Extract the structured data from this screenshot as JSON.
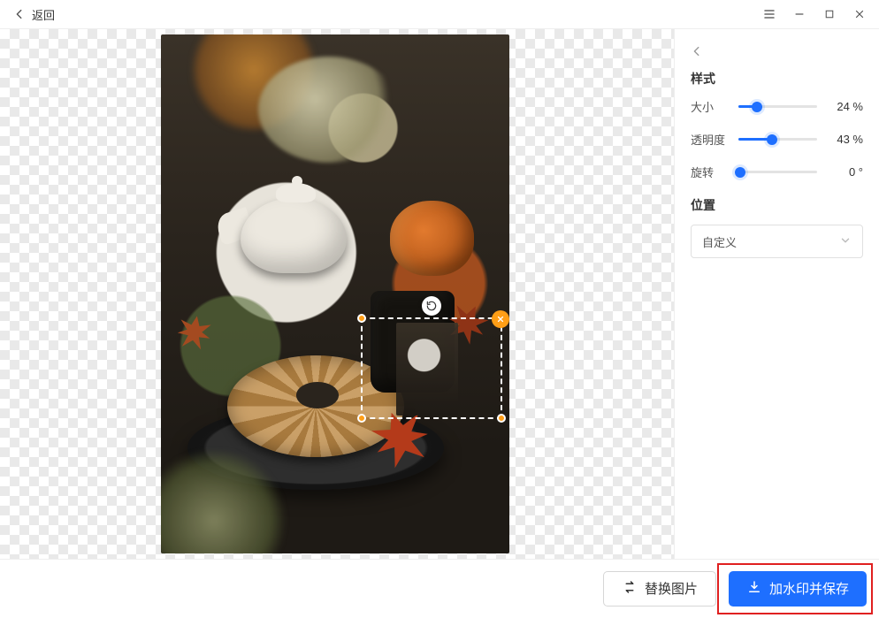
{
  "titlebar": {
    "back_label": "返回"
  },
  "panel": {
    "style_heading": "样式",
    "controls": {
      "size": {
        "label": "大小",
        "value_text": "24 %",
        "percent": 24
      },
      "opacity": {
        "label": "透明度",
        "value_text": "43 %",
        "percent": 43
      },
      "rotate": {
        "label": "旋转",
        "value_text": "0  °",
        "percent": 0
      }
    },
    "position_heading": "位置",
    "position_select": {
      "selected": "自定义"
    }
  },
  "bottombar": {
    "replace_label": "替换图片",
    "save_label": "加水印并保存"
  }
}
